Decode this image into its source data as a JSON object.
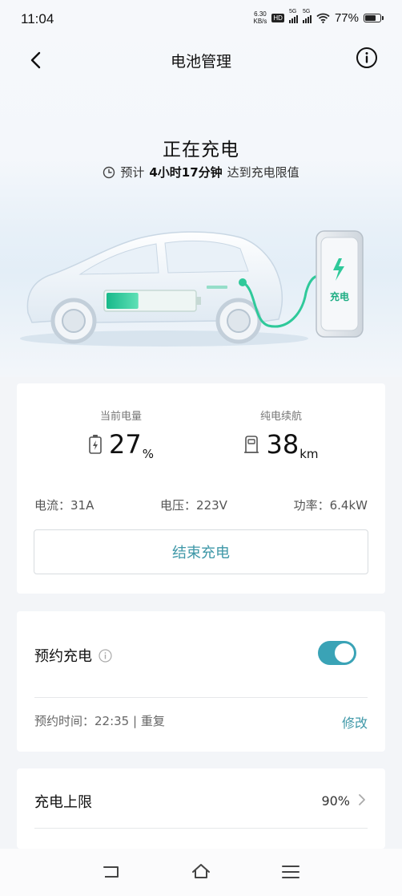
{
  "status_bar": {
    "time": "11:04",
    "net_speed_value": "6.30",
    "net_speed_unit": "KB/s",
    "hd_label": "HD",
    "sim1_label": "5G",
    "sim2_label": "5G",
    "battery_percent": "77%",
    "battery_level": 0.77
  },
  "header": {
    "title": "电池管理",
    "back_icon": "chevron-left-icon",
    "info_icon": "info-circle-icon"
  },
  "hero": {
    "title": "正在充电",
    "subtitle_prefix": "预计",
    "subtitle_duration": "4小时17分钟",
    "subtitle_suffix": "达到充电限值",
    "charger_label": "充电",
    "battery_fill_level": 0.27,
    "colors": {
      "accent": "#3f98a8",
      "battery_green": "#2fc99a"
    }
  },
  "stats": {
    "charge_label": "当前电量",
    "charge_value": "27",
    "charge_unit": "%",
    "range_label": "纯电续航",
    "range_value": "38",
    "range_unit": "km",
    "current_text": "电流：31A",
    "voltage_text": "电压：223V",
    "power_text": "功率：6.4kW",
    "stop_button": "结束充电"
  },
  "reserve": {
    "title": "预约充电",
    "enabled": true,
    "time_text": "预约时间：22:35 | 重复",
    "edit_label": "修改"
  },
  "limit": {
    "title": "充电上限",
    "value": "90%"
  },
  "nav": {
    "back_icon": "nav-back-icon",
    "home_icon": "nav-home-icon",
    "menu_icon": "nav-menu-icon"
  }
}
